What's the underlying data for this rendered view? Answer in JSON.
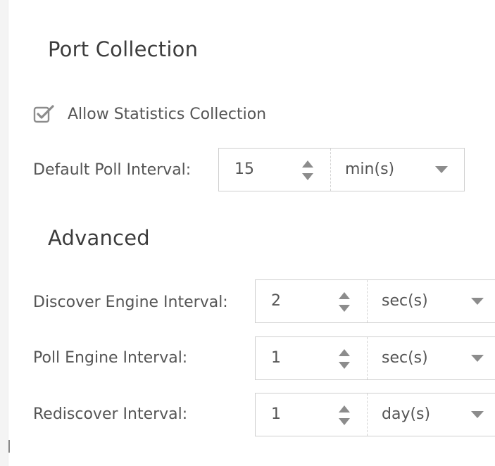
{
  "port_collection": {
    "title": "Port Collection",
    "allow_statistics": {
      "label": "Allow Statistics Collection",
      "checked": true
    },
    "default_poll_interval": {
      "label": "Default Poll Interval:",
      "value": "15",
      "unit": "min(s)"
    }
  },
  "advanced": {
    "title": "Advanced",
    "discover_engine_interval": {
      "label": "Discover Engine Interval:",
      "value": "2",
      "unit": "sec(s)"
    },
    "poll_engine_interval": {
      "label": "Poll Engine Interval:",
      "value": "1",
      "unit": "sec(s)"
    },
    "rediscover_interval": {
      "label": "Rediscover Interval:",
      "value": "1",
      "unit": "day(s)"
    }
  },
  "icons": {
    "checkbox": "checkbox-checked-icon",
    "spinner": "spinner-up-down-icon",
    "dropdown": "caret-down-icon"
  },
  "colors": {
    "text": "#555555",
    "heading": "#3c3c3c",
    "border": "#cfcfcf",
    "icon": "#8c8c8c"
  }
}
